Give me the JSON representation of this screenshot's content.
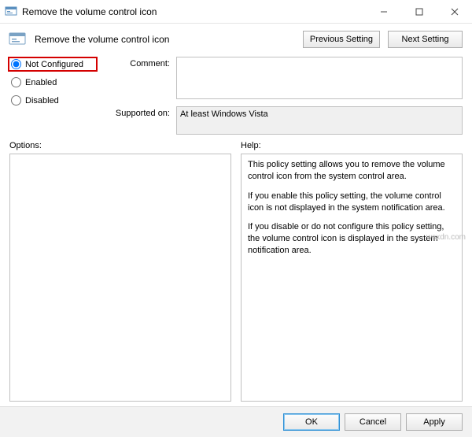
{
  "window": {
    "title": "Remove the volume control icon"
  },
  "header": {
    "title": "Remove the volume control icon",
    "prev_btn": "Previous Setting",
    "next_btn": "Next Setting"
  },
  "state": {
    "not_configured": "Not Configured",
    "enabled": "Enabled",
    "disabled": "Disabled",
    "selected": "not_configured"
  },
  "labels": {
    "comment": "Comment:",
    "supported_on": "Supported on:",
    "options": "Options:",
    "help": "Help:"
  },
  "fields": {
    "comment": "",
    "supported_on": "At least Windows Vista"
  },
  "help": {
    "p1": "This policy setting allows you to remove the volume control icon from the system control area.",
    "p2": "If you enable this policy setting, the volume control icon is not displayed in the system notification area.",
    "p3": "If you disable or do not configure this policy setting, the volume control icon is displayed in the system notification area."
  },
  "footer": {
    "ok": "OK",
    "cancel": "Cancel",
    "apply": "Apply"
  },
  "watermark": "wsxdn.com"
}
